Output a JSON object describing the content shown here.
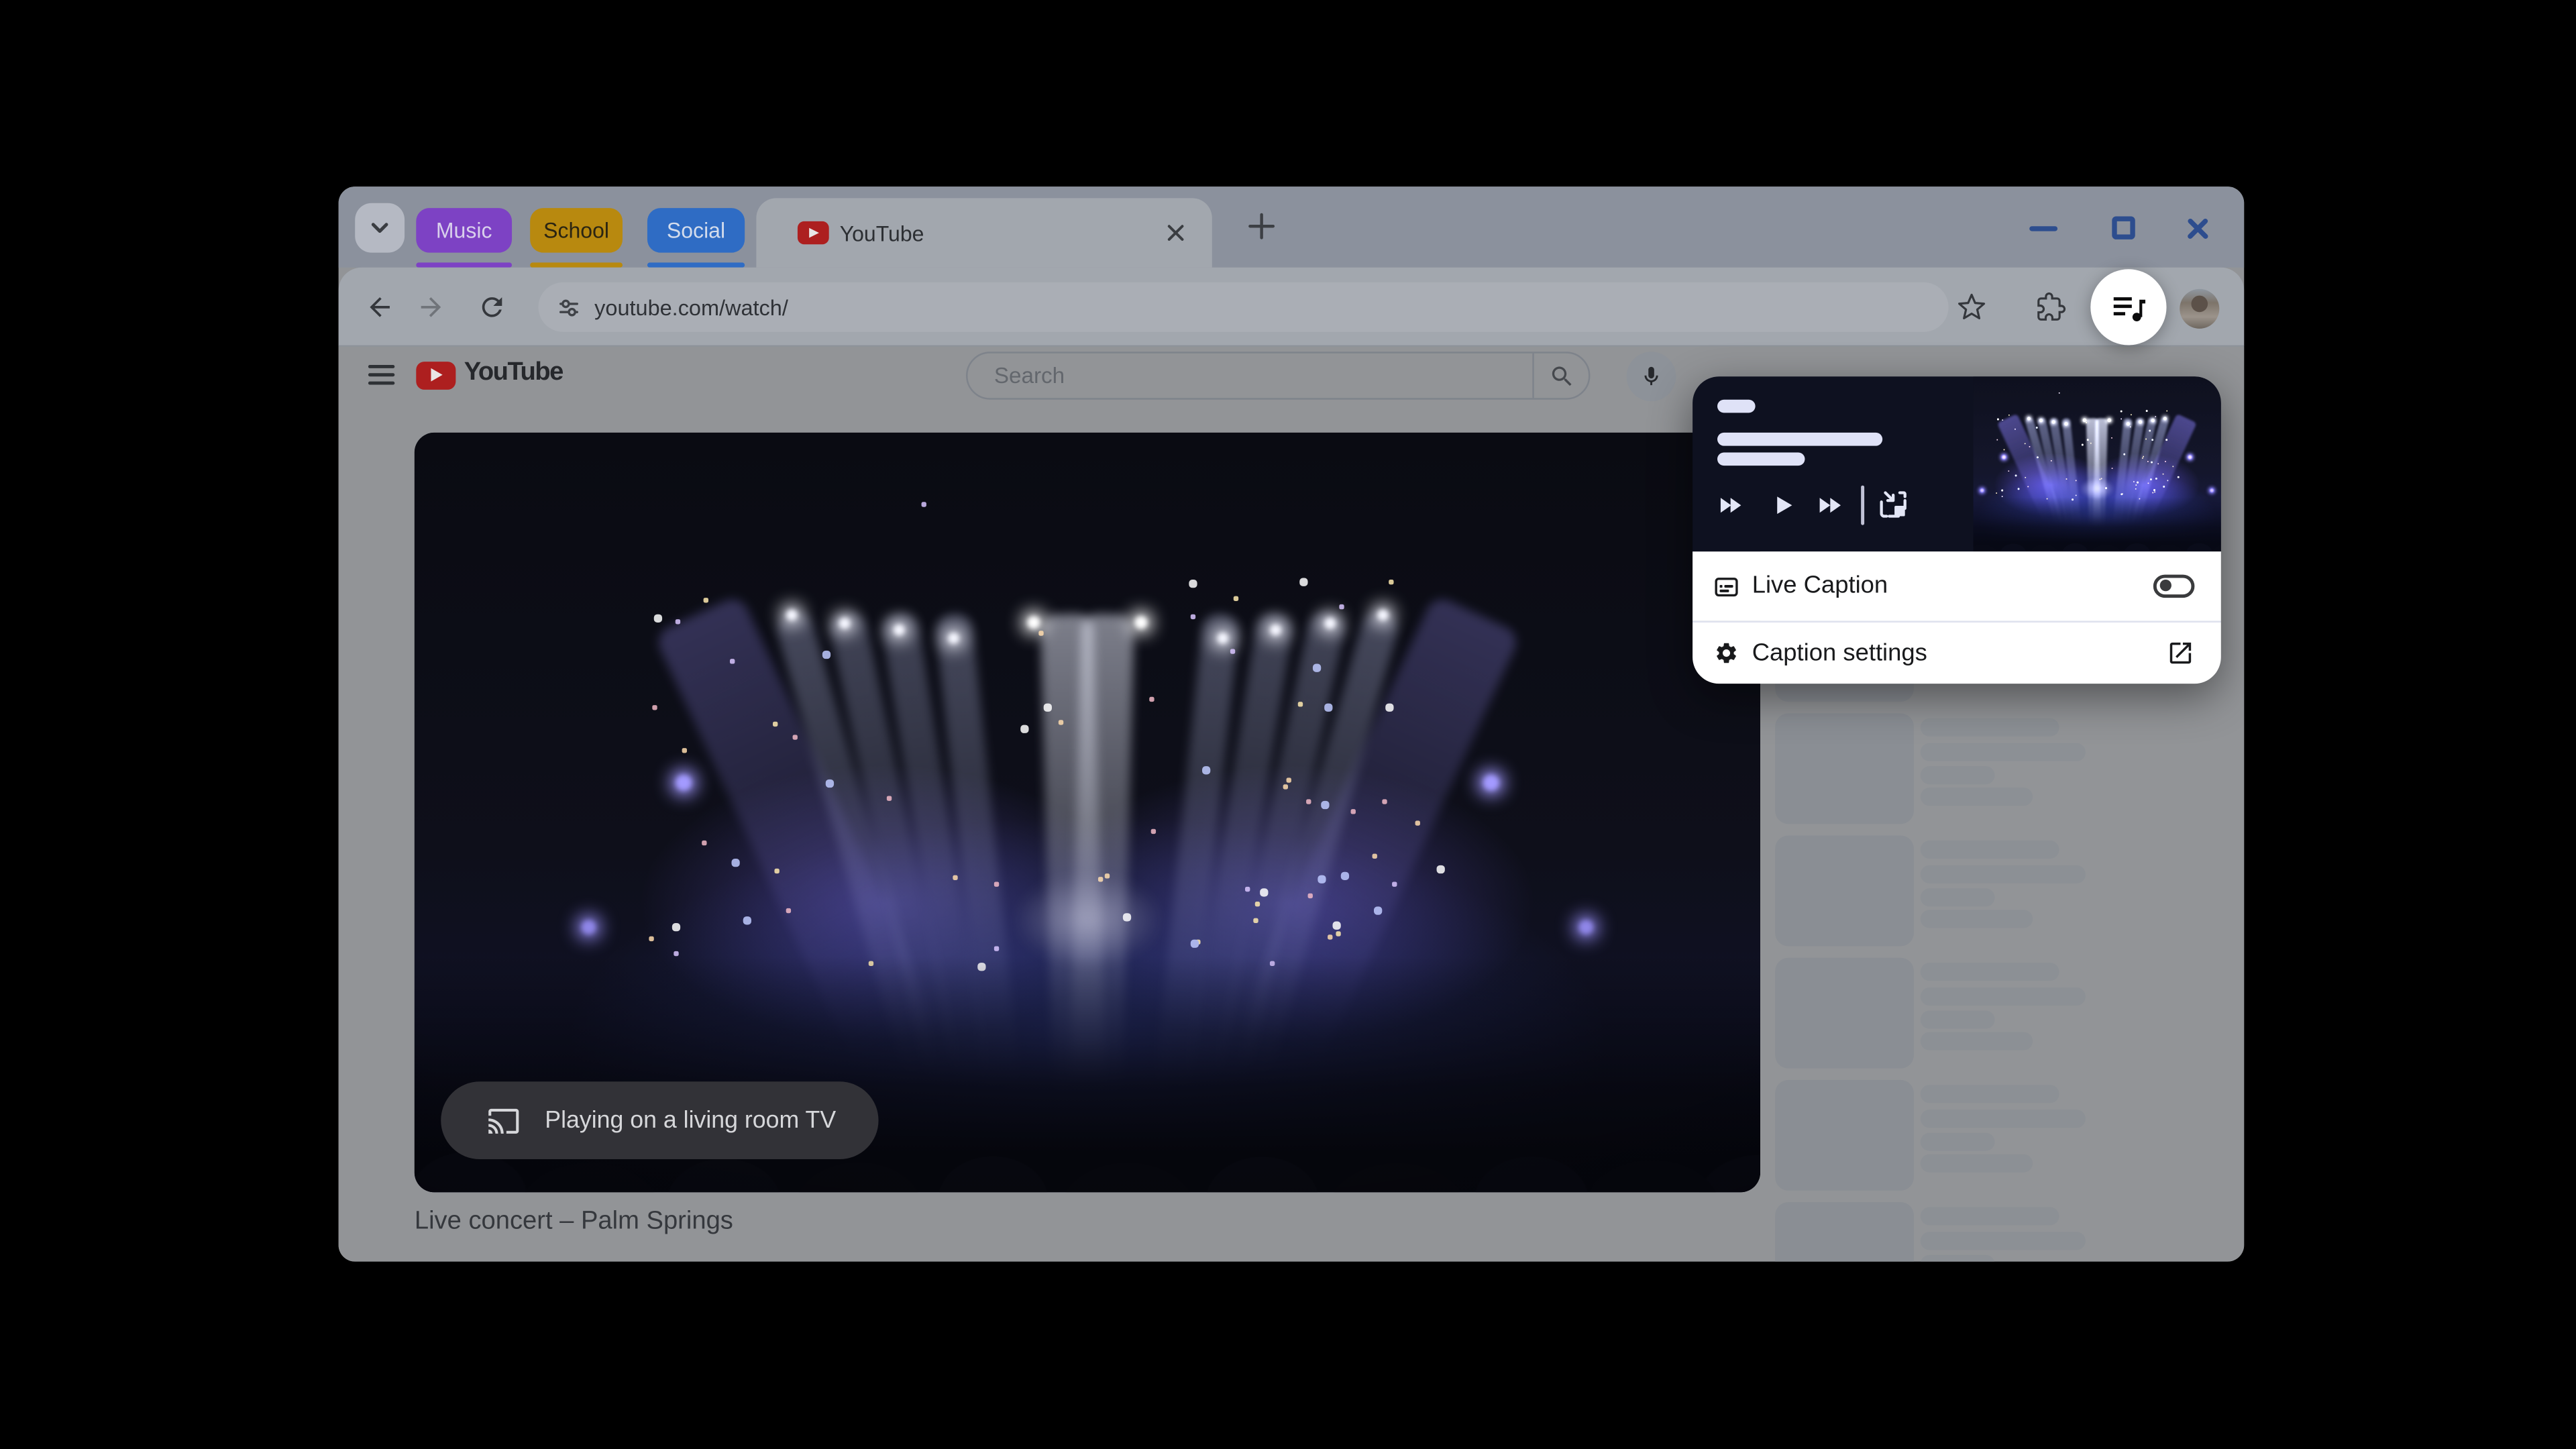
{
  "window": {
    "controls": {
      "minimize_icon": "minimize-icon",
      "maximize_icon": "maximize-icon",
      "close_icon": "close-icon"
    }
  },
  "tab_strip": {
    "groups": [
      {
        "label": "Music",
        "color": "#7d42c4"
      },
      {
        "label": "School",
        "color": "#b8890f"
      },
      {
        "label": "Social",
        "color": "#2f6cc4"
      }
    ],
    "active_tab": {
      "title": "YouTube",
      "favicon": "youtube-icon"
    }
  },
  "toolbar": {
    "url": "youtube.com/watch/"
  },
  "page": {
    "search_placeholder": "Search",
    "video_title": "Live concert – Palm Springs",
    "cast_chip_label": "Playing on a living room TV",
    "sidebar_skeleton_count": 6
  },
  "media_popup": {
    "live_caption_label": "Live Caption",
    "live_caption_state": "off",
    "caption_settings_label": "Caption settings"
  },
  "colors": {
    "group_music": "#7d42c4",
    "group_school": "#b8890f",
    "group_social": "#2f6cc4",
    "popup_card_bg": "#0e1120",
    "window_control_blue": "#2d4d8e",
    "youtube_red": "#ad1f1f"
  }
}
